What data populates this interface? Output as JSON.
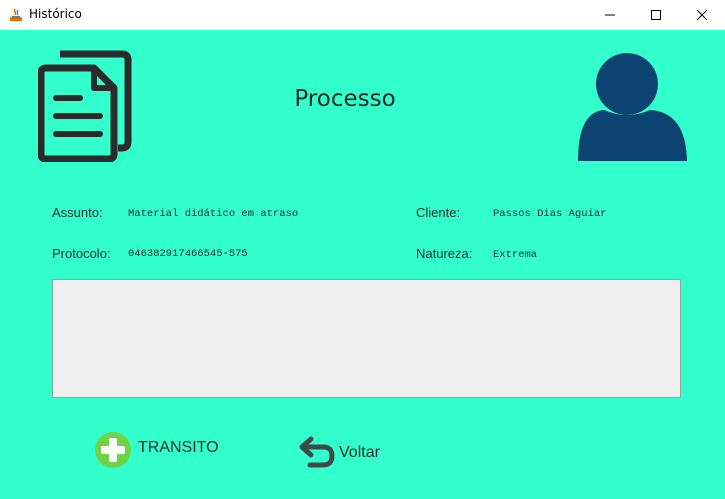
{
  "window": {
    "title": "Histórico",
    "controls": [
      "minimize",
      "maximize",
      "close"
    ]
  },
  "header": {
    "title": "Processo",
    "left_icon": "documents-icon",
    "right_icon": "user-avatar-icon",
    "avatar_color": "#0d4370"
  },
  "fields": {
    "assunto_label": "Assunto:",
    "assunto_value": "Material didático em atraso",
    "cliente_label": "Cliente:",
    "cliente_value": "Passos Dias Aguiar",
    "protocolo_label": "Protocolo:",
    "protocolo_value": "046382917466545-575",
    "natureza_label": "Natureza:",
    "natureza_value": "Extrema"
  },
  "notes": {
    "value": ""
  },
  "actions": {
    "transito_label": "TRANSITO",
    "transito_icon": "plus-circle-icon",
    "voltar_label": "Voltar",
    "voltar_icon": "undo-arrow-icon"
  },
  "colors": {
    "background": "#33ffcc",
    "accent_green": "#6ed346",
    "dark": "#2b2b2b"
  }
}
